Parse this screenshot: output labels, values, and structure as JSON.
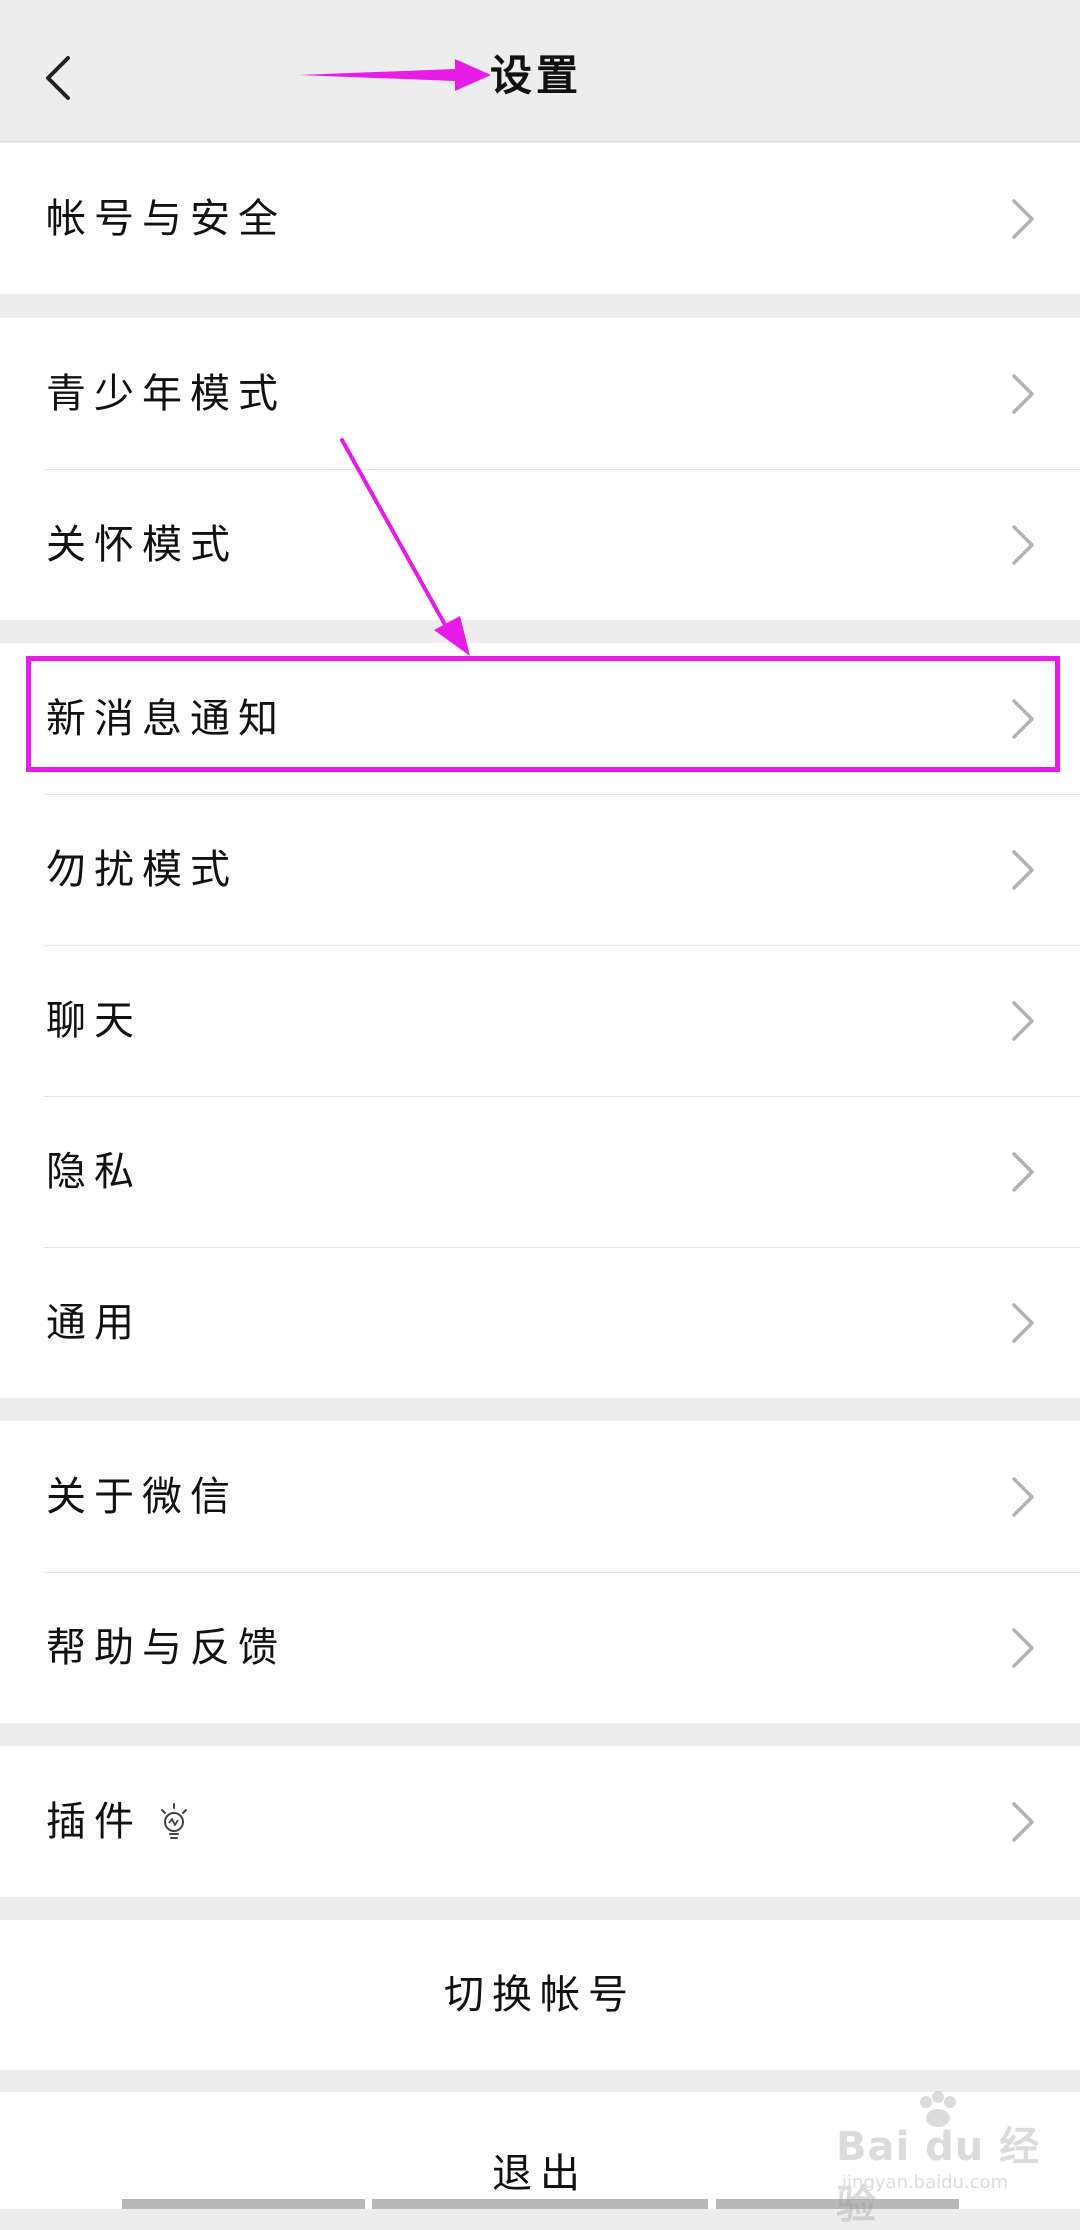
{
  "header": {
    "title": "设置",
    "back_icon": "chevron-left-icon"
  },
  "groups": [
    {
      "items": [
        {
          "label": "帐号与安全"
        }
      ]
    },
    {
      "items": [
        {
          "label": "青少年模式"
        },
        {
          "label": "关怀模式"
        }
      ]
    },
    {
      "items": [
        {
          "label": "新消息通知"
        },
        {
          "label": "勿扰模式"
        },
        {
          "label": "聊天"
        },
        {
          "label": "隐私"
        },
        {
          "label": "通用"
        }
      ]
    },
    {
      "items": [
        {
          "label": "关于微信"
        },
        {
          "label": "帮助与反馈"
        }
      ]
    },
    {
      "items": [
        {
          "label": "插件",
          "extra_icon": "lightbulb-icon"
        }
      ]
    }
  ],
  "actions": {
    "switch_account": "切换帐号",
    "logout": "退出"
  },
  "watermark": {
    "text": "Bai du 经验",
    "sub": "jingyan.baidu.com"
  },
  "colors": {
    "background": "#ededed",
    "surface": "#ffffff",
    "annotation": "#e81ce8",
    "chevron": "#b2b2b2"
  }
}
